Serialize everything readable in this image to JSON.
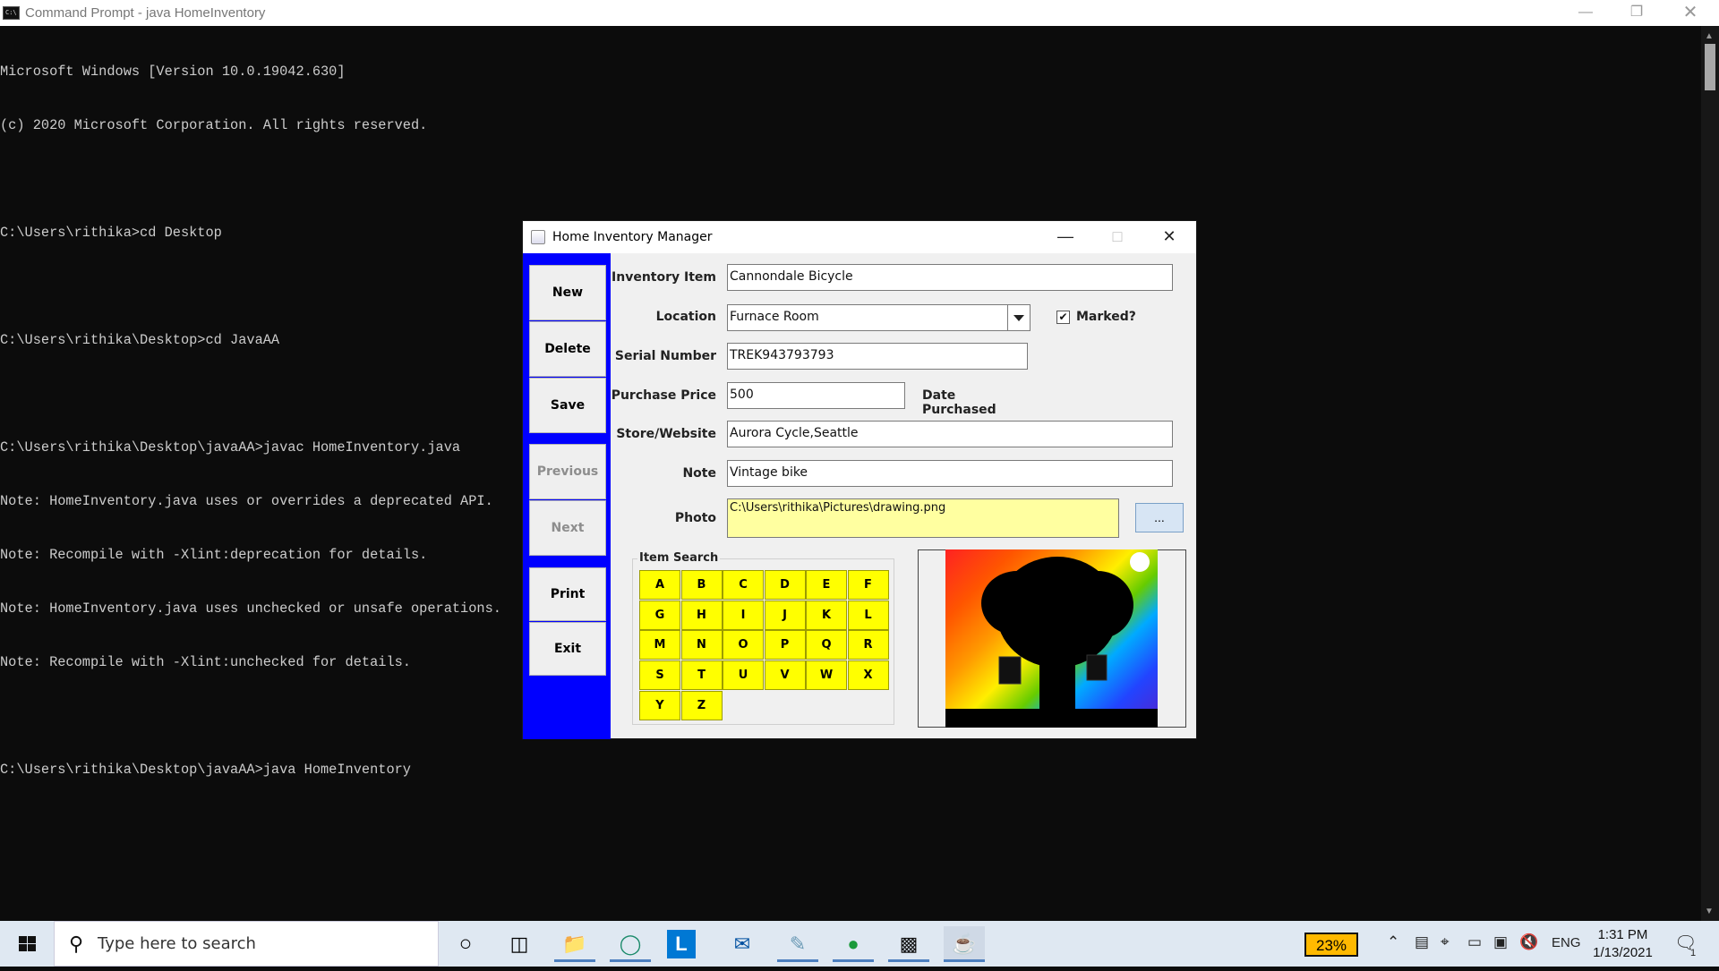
{
  "console": {
    "title": "Command Prompt - java  HomeInventory",
    "lines": [
      "Microsoft Windows [Version 10.0.19042.630]",
      "(c) 2020 Microsoft Corporation. All rights reserved.",
      "",
      "C:\\Users\\rithika>cd Desktop",
      "",
      "C:\\Users\\rithika\\Desktop>cd JavaAA",
      "",
      "C:\\Users\\rithika\\Desktop\\javaAA>javac HomeInventory.java",
      "Note: HomeInventory.java uses or overrides a deprecated API.",
      "Note: Recompile with -Xlint:deprecation for details.",
      "Note: HomeInventory.java uses unchecked or unsafe operations.",
      "Note: Recompile with -Xlint:unchecked for details.",
      "",
      "C:\\Users\\rithika\\Desktop\\javaAA>java HomeInventory"
    ]
  },
  "app": {
    "title": "Home Inventory Manager",
    "buttons": {
      "new": "New",
      "delete": "Delete",
      "save": "Save",
      "previous": "Previous",
      "next": "Next",
      "print": "Print",
      "exit": "Exit"
    },
    "fields": {
      "item_label": "Inventory Item",
      "item_value": "Cannondale Bicycle",
      "location_label": "Location",
      "location_value": "Furnace Room",
      "marked_label": "Marked?",
      "marked_checked": true,
      "serial_label": "Serial Number",
      "serial_value": "TREK943793793",
      "price_label": "Purchase Price",
      "price_value": "500",
      "date_label": "Date Purchased",
      "store_label": "Store/Website",
      "store_value": "Aurora Cycle,Seattle",
      "note_label": "Note",
      "note_value": "Vintage bike",
      "photo_label": "Photo",
      "photo_value": "C:\\Users\\rithika\\Pictures\\drawing.png",
      "browse_label": "..."
    },
    "search": {
      "title": "Item Search",
      "letters": [
        "A",
        "B",
        "C",
        "D",
        "E",
        "F",
        "G",
        "H",
        "I",
        "J",
        "K",
        "L",
        "M",
        "N",
        "O",
        "P",
        "Q",
        "R",
        "S",
        "T",
        "U",
        "V",
        "W",
        "X",
        "Y",
        "Z"
      ]
    }
  },
  "taskbar": {
    "search_placeholder": "Type here to search",
    "battery": "23%",
    "language": "ENG",
    "time": "1:31 PM",
    "date": "1/13/2021",
    "notification_count": "1",
    "pinned": [
      "cortana-icon",
      "task-view-icon",
      "file-explorer-icon",
      "edge-icon",
      "l-app-icon",
      "mail-icon",
      "paint-icon",
      "maps-icon",
      "command-prompt-icon",
      "java-icon"
    ]
  },
  "colors": {
    "console_bg": "#0c0c0c",
    "button_panel": "#0000ff",
    "letter_button": "#ffff00",
    "photo_field": "#ffffa0",
    "battery_badge": "#ffb900"
  }
}
